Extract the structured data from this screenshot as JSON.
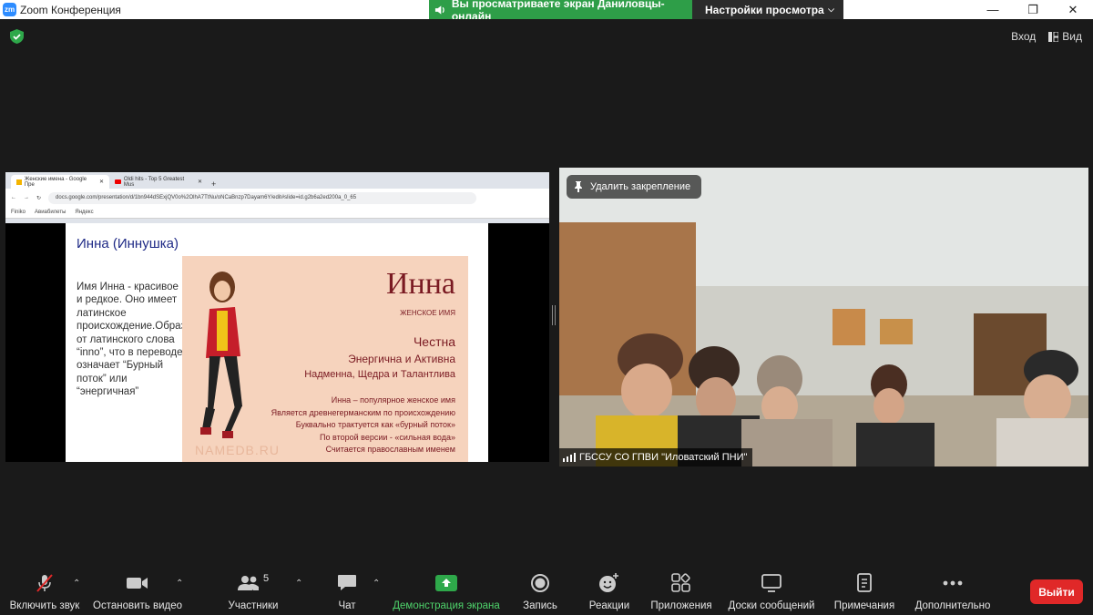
{
  "window": {
    "title": "Zoom Конференция",
    "share_banner": "Вы просматриваете экран Даниловцы-онлайн",
    "view_settings": "Настройки просмотра"
  },
  "top_right": {
    "login": "Вход",
    "view": "Вид"
  },
  "shared_screen": {
    "browser": {
      "tabs": [
        {
          "title": "Женские имена - Google Пре"
        },
        {
          "title": "Oldi hits - Top 5 Greatest Mus"
        }
      ],
      "url": "docs.google.com/presentation/d/1bn944dSExjQV0o%2OlhA7TtNu/oNCaBnzp7Dayam6Y/edit#slide=id.g2b6a2ed200a_0_65",
      "bookmarks": [
        "Finiko",
        "Авиабилеты",
        "Яндекс"
      ]
    },
    "slide": {
      "title": "Инна (Иннушка)",
      "text": "Имя Инна - красивое и редкое. Оно имеет латинское происхождение.Образовалось от латинского слова “inno”, что в переводе означает “Бурный поток” или “энергичная”",
      "card": {
        "name": "Инна",
        "subtitle": "ЖЕНСКОЕ ИМЯ",
        "line1": "Честна",
        "line2": "Энергична и Активна",
        "line3": "Надменна, Щедра и Талантлива",
        "facts": [
          "Инна – популярное женское имя",
          "Является древнегерманским по происхождению",
          "Буквально трактуется как «бурный поток»",
          "По второй версии - «сильная вода»",
          "Считается православным именем"
        ],
        "logo": "NAMEDB.RU"
      }
    }
  },
  "video": {
    "unpin_label": "Удалить закрепление",
    "participant_name": "ГБССУ СО ГПВИ \"Иловатский ПНИ\""
  },
  "toolbar": {
    "unmute": "Включить звук",
    "stop_video": "Остановить видео",
    "participants": "Участники",
    "participants_count": "5",
    "chat": "Чат",
    "share_screen": "Демонстрация экрана",
    "record": "Запись",
    "reactions": "Реакции",
    "apps": "Приложения",
    "whiteboards": "Доски сообщений",
    "notes": "Примечания",
    "more": "Дополнительно",
    "leave": "Выйти"
  },
  "colors": {
    "share_banner": "#2e9e48",
    "leave_button": "#e02828",
    "share_green": "#4ed36b"
  }
}
